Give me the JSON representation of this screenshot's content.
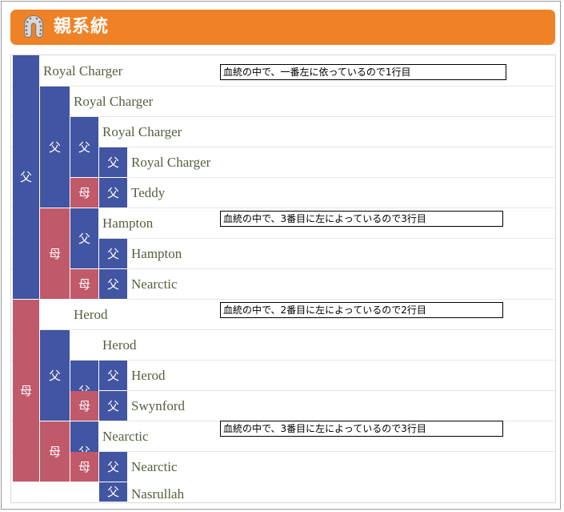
{
  "header": {
    "title": "親系統",
    "icon": "horseshoe-icon",
    "background_color": "#ef8227",
    "text_color": "#ffffff"
  },
  "legend": {
    "sire_symbol": "父",
    "dam_symbol": "母",
    "sire_color": "#4155a2",
    "dam_color": "#c0596a",
    "name_color": "#54603f"
  },
  "pedigree": {
    "rows": [
      {
        "generation": 1,
        "symbol": "父",
        "type": "sire",
        "name": "Royal Charger"
      },
      {
        "generation": 2,
        "symbol": "父",
        "type": "sire",
        "name": "Royal Charger"
      },
      {
        "generation": 3,
        "symbol": "父",
        "type": "sire",
        "name": "Royal Charger"
      },
      {
        "generation": 4,
        "symbol": "父",
        "type": "sire",
        "name": "Royal Charger"
      },
      {
        "generation": 4,
        "symbol": "父",
        "type": "sire",
        "name": "Teddy"
      },
      {
        "generation": 3,
        "symbol": "父",
        "type": "sire",
        "name": "Hampton"
      },
      {
        "generation": 4,
        "symbol": "父",
        "type": "sire",
        "name": "Hampton"
      },
      {
        "generation": 4,
        "symbol": "父",
        "type": "sire",
        "name": "Nearctic"
      },
      {
        "generation": 2,
        "symbol": "父",
        "type": "sire",
        "name": "Herod"
      },
      {
        "generation": 3,
        "symbol": "父",
        "type": "sire",
        "name": "Herod"
      },
      {
        "generation": 4,
        "symbol": "父",
        "type": "sire",
        "name": "Herod"
      },
      {
        "generation": 4,
        "symbol": "父",
        "type": "sire",
        "name": "Swynford"
      },
      {
        "generation": 3,
        "symbol": "父",
        "type": "sire",
        "name": "Nearctic"
      },
      {
        "generation": 4,
        "symbol": "父",
        "type": "sire",
        "name": "Nearctic"
      },
      {
        "generation": 4,
        "symbol": "父",
        "type": "sire",
        "name": "Nasrullah"
      }
    ],
    "names": {
      "r1": "Royal Charger",
      "r2": "Royal Charger",
      "r3": "Royal Charger",
      "r4": "Royal Charger",
      "r5": "Teddy",
      "r6": "Hampton",
      "r7": "Hampton",
      "r8": "Nearctic",
      "r9": "Herod",
      "r10": "Herod",
      "r11": "Herod",
      "r12": "Swynford",
      "r13": "Nearctic",
      "r14": "Nearctic",
      "r15": "Nasrullah"
    },
    "symbols": {
      "g1a": "父",
      "g1b": "母",
      "g2a": "父",
      "g2b": "母",
      "g2c": "父",
      "g2d": "母",
      "g3a": "父",
      "g3b": "母",
      "g3c": "父",
      "g3d": "母",
      "g3e": "父",
      "g3f": "母",
      "g3g": "父",
      "g3h": "母",
      "g4a": "父",
      "g4b": "父",
      "g4c": "父",
      "g4d": "父",
      "g4e": "父",
      "g4f": "父",
      "g4g": "父",
      "g4h": "父"
    }
  },
  "notes": {
    "note1": "血統の中で、一番左に依っているので1行目",
    "note2": "血統の中で、3番目に左によっているので3行目",
    "note3": "血統の中で、2番目に左によっているので2行目",
    "note4": "血統の中で、3番目に左によっているので3行目"
  }
}
